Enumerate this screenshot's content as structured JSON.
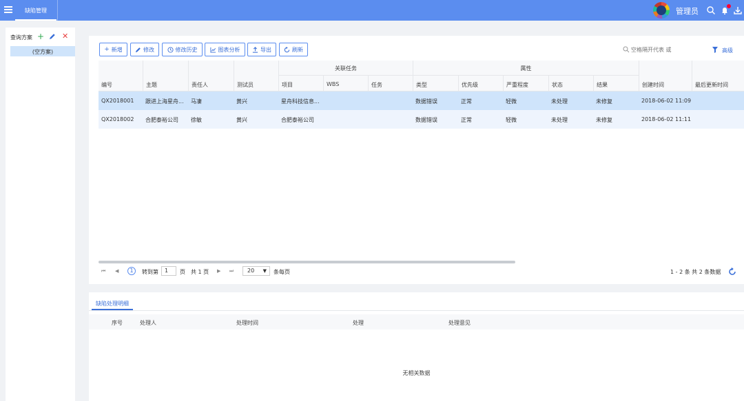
{
  "app": {
    "tab": "缺陷管理",
    "user": "管理员"
  },
  "left": {
    "title": "查询方案",
    "plan_item": "(空方案)"
  },
  "toolbar": {
    "buttons": [
      {
        "icon": "plus-icon",
        "label": "新增"
      },
      {
        "icon": "pencil-icon",
        "label": "修改"
      },
      {
        "icon": "clock-icon",
        "label": "修改历史"
      },
      {
        "icon": "chart-icon",
        "label": "图表分析"
      },
      {
        "icon": "export-icon",
        "label": "导出"
      },
      {
        "icon": "refresh-icon",
        "label": "刷新"
      }
    ],
    "search_placeholder": "空格隔开代表 或",
    "advanced": "高级"
  },
  "grid": {
    "groups": [
      "关联任务",
      "属性"
    ],
    "columns": [
      "编号",
      "主题",
      "责任人",
      "测试员",
      "项目",
      "WBS",
      "任务",
      "类型",
      "优先级",
      "严重程度",
      "状态",
      "结果",
      "创建时间",
      "最后更新时间"
    ],
    "rows": [
      [
        "QX2018001",
        "跟进上海星舟...",
        "马凄",
        "黄兴",
        "星舟科技信息...",
        "",
        "",
        "数据错误",
        "正常",
        "轻微",
        "未处理",
        "未修复",
        "2018-06-02 11:09",
        ""
      ],
      [
        "QX2018002",
        "合肥泰裕公司",
        "徐敏",
        "黄兴",
        "合肥泰裕公司",
        "",
        "",
        "数据错误",
        "正常",
        "轻微",
        "未处理",
        "未修复",
        "2018-06-02 11:11",
        ""
      ]
    ]
  },
  "pager": {
    "current_page": "1",
    "goto_label": "转到第",
    "page_input": "1",
    "page_suffix": "页",
    "total_pages": "共 1 页",
    "page_size": "20",
    "per_page": "条每页",
    "summary": "1 - 2 条  共 2 条数据"
  },
  "detail": {
    "tab": "缺陷处理明细",
    "columns": [
      "序号",
      "处理人",
      "处理时间",
      "处理",
      "处理意见"
    ],
    "empty": "无相关数据"
  },
  "colors": {
    "topbar": "#5b8def",
    "accent": "#3a6fd8",
    "selected_row": "#cfe4fb"
  }
}
